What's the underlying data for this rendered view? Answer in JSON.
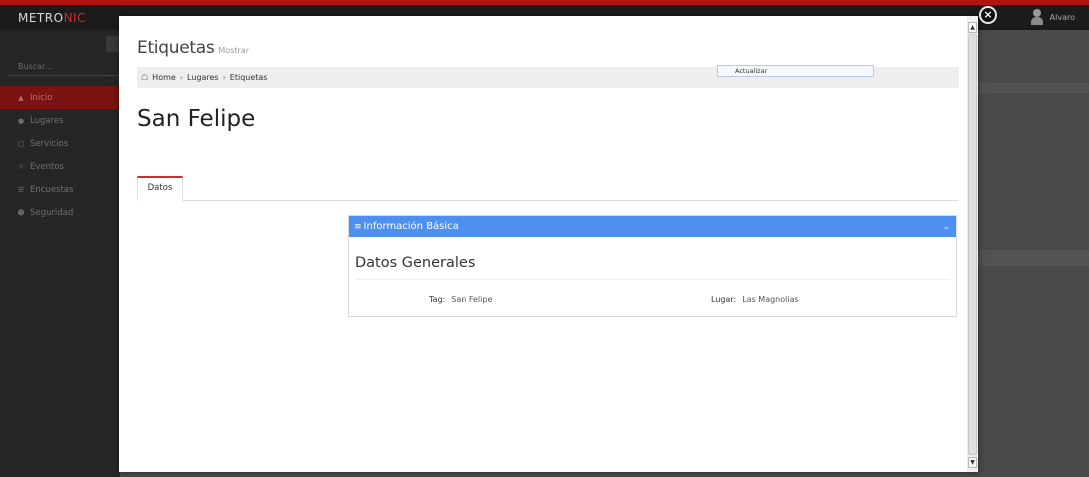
{
  "app": {
    "brand_part1": "METRO",
    "brand_part2": "NIC",
    "user_name": "Alvaro"
  },
  "sidebar": {
    "search_placeholder": "Buscar...",
    "items": [
      {
        "label": "Inicio",
        "icon": "home-icon"
      },
      {
        "label": "Lugares",
        "icon": "map-marker-icon"
      },
      {
        "label": "Servicios",
        "icon": "bar-chart-icon"
      },
      {
        "label": "Eventos",
        "icon": "settings-icon"
      },
      {
        "label": "Encuestas",
        "icon": "list-icon"
      },
      {
        "label": "Seguridad",
        "icon": "user-icon"
      }
    ]
  },
  "modal": {
    "title": "Etiquetas",
    "subtitle": "Mostrar",
    "breadcrumb": [
      "Home",
      "Lugares",
      "Etiquetas"
    ],
    "action_label": "Actualizar",
    "record_title": "San Felipe",
    "tabs": [
      {
        "label": "Datos"
      }
    ],
    "portlet": {
      "title": "Información Básica",
      "section_title": "Datos Generales",
      "fields": [
        {
          "label": "Tag:",
          "value": "San Felipe"
        },
        {
          "label": "Lugar:",
          "value": "Las Magnolias"
        }
      ]
    }
  },
  "colors": {
    "brand_red": "#c9302c",
    "portlet_blue": "#4d90f0",
    "overlay": "#3a3a3a"
  }
}
